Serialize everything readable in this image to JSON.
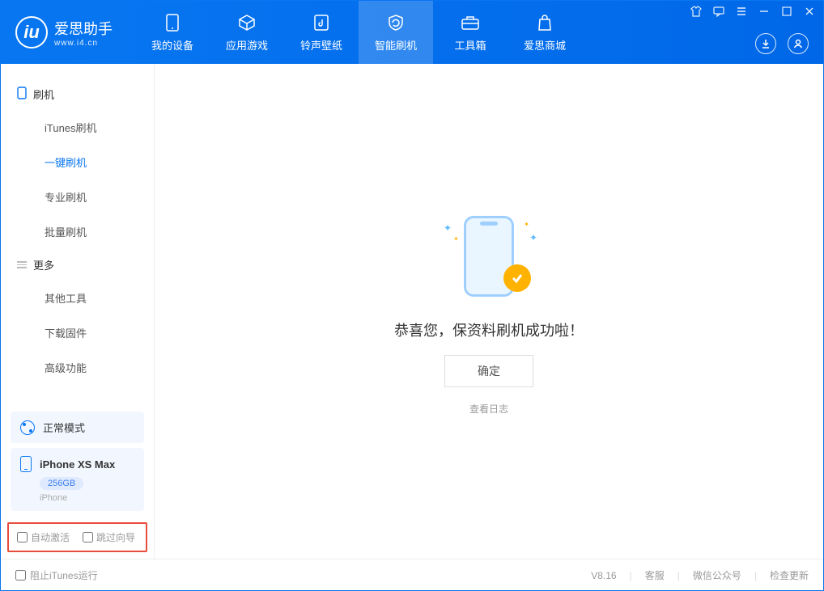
{
  "logo": {
    "badge": "iu",
    "title": "爱思助手",
    "sub": "www.i4.cn"
  },
  "nav": {
    "items": [
      {
        "label": "我的设备"
      },
      {
        "label": "应用游戏"
      },
      {
        "label": "铃声壁纸"
      },
      {
        "label": "智能刷机"
      },
      {
        "label": "工具箱"
      },
      {
        "label": "爱思商城"
      }
    ]
  },
  "sidebar": {
    "section1": "刷机",
    "items1": [
      "iTunes刷机",
      "一键刷机",
      "专业刷机",
      "批量刷机"
    ],
    "section2": "更多",
    "items2": [
      "其他工具",
      "下载固件",
      "高级功能"
    ],
    "mode": "正常模式",
    "device": {
      "name": "iPhone XS Max",
      "storage": "256GB",
      "type": "iPhone"
    },
    "chk1": "自动激活",
    "chk2": "跳过向导"
  },
  "main": {
    "message": "恭喜您，保资料刷机成功啦！",
    "ok": "确定",
    "log": "查看日志"
  },
  "footer": {
    "block_itunes": "阻止iTunes运行",
    "version": "V8.16",
    "links": [
      "客服",
      "微信公众号",
      "检查更新"
    ]
  }
}
